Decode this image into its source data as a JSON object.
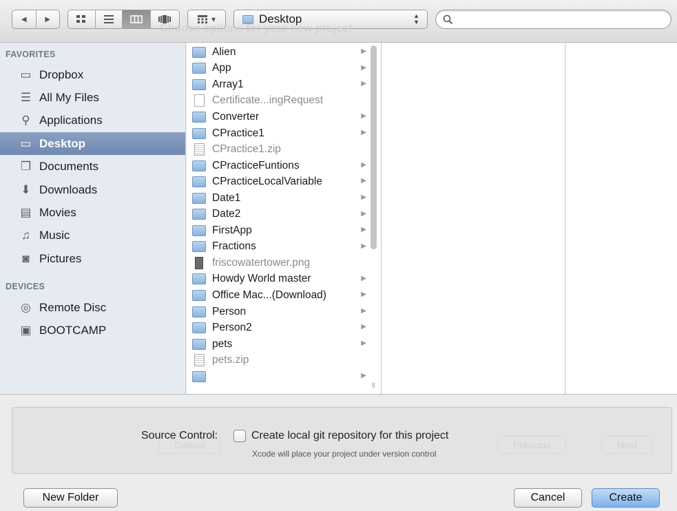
{
  "toolbar": {
    "back_icon": "◀",
    "forward_icon": "▶",
    "view_icons": [
      "icon-view-icon",
      "list-view-icon",
      "column-view-icon",
      "coverflow-view-icon"
    ],
    "arrange_icon": "▾",
    "location": "Desktop",
    "search_placeholder": ""
  },
  "ghost_title": "Choose options for your new project",
  "sidebar": {
    "favorites_header": "FAVORITES",
    "devices_header": "DEVICES",
    "favorites": [
      {
        "label": "Dropbox",
        "icon": "folder-icon",
        "glyph": "▭"
      },
      {
        "label": "All My Files",
        "icon": "all-files-icon",
        "glyph": "☰"
      },
      {
        "label": "Applications",
        "icon": "applications-icon",
        "glyph": "⚲"
      },
      {
        "label": "Desktop",
        "icon": "desktop-icon",
        "glyph": "▭",
        "selected": true
      },
      {
        "label": "Documents",
        "icon": "documents-icon",
        "glyph": "❐"
      },
      {
        "label": "Downloads",
        "icon": "downloads-icon",
        "glyph": "⬇"
      },
      {
        "label": "Movies",
        "icon": "movies-icon",
        "glyph": "▤"
      },
      {
        "label": "Music",
        "icon": "music-icon",
        "glyph": "♫"
      },
      {
        "label": "Pictures",
        "icon": "pictures-icon",
        "glyph": "◙"
      }
    ],
    "devices": [
      {
        "label": "Remote Disc",
        "icon": "remote-disc-icon",
        "glyph": "◎"
      },
      {
        "label": "BOOTCAMP",
        "icon": "drive-icon",
        "glyph": "▣"
      }
    ]
  },
  "files": [
    {
      "name": "Alien",
      "type": "folder"
    },
    {
      "name": "App",
      "type": "folder"
    },
    {
      "name": "Array1",
      "type": "folder"
    },
    {
      "name": "Certificate...ingRequest",
      "type": "doc"
    },
    {
      "name": "Converter",
      "type": "folder"
    },
    {
      "name": "CPractice1",
      "type": "folder"
    },
    {
      "name": "CPractice1.zip",
      "type": "zip"
    },
    {
      "name": "CPracticeFuntions",
      "type": "folder"
    },
    {
      "name": "CPracticeLocalVariable",
      "type": "folder"
    },
    {
      "name": "Date1",
      "type": "folder"
    },
    {
      "name": "Date2",
      "type": "folder"
    },
    {
      "name": "FirstApp",
      "type": "folder"
    },
    {
      "name": "Fractions",
      "type": "folder"
    },
    {
      "name": "friscowatertower.png",
      "type": "image"
    },
    {
      "name": "Howdy World master",
      "type": "folder"
    },
    {
      "name": "Office Mac...(Download)",
      "type": "folder"
    },
    {
      "name": "Person",
      "type": "folder"
    },
    {
      "name": "Person2",
      "type": "folder"
    },
    {
      "name": "pets",
      "type": "folder"
    },
    {
      "name": "pets.zip",
      "type": "zip"
    },
    {
      "name": "",
      "type": "folder"
    }
  ],
  "source_control": {
    "label": "Source Control:",
    "checkbox_label": "Create local git repository for this project",
    "note": "Xcode will place your project under version control",
    "checked": false
  },
  "ghost_buttons": {
    "cancel": "Cancel",
    "previous": "Previous",
    "next": "Next"
  },
  "buttons": {
    "new_folder": "New Folder",
    "cancel": "Cancel",
    "create": "Create"
  },
  "colors": {
    "selection": "#7d93b9",
    "sidebar_bg": "#e6ebf2",
    "primary_button": "#7eb1ea"
  }
}
